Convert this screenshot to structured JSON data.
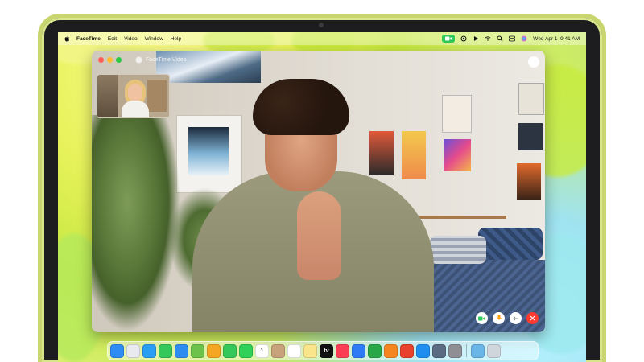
{
  "menubar": {
    "app_name": "FaceTime",
    "items": [
      "Edit",
      "Video",
      "Window",
      "Help"
    ],
    "date_time": "Wed Apr 1  9:41 AM"
  },
  "window": {
    "title": "FaceTime Video",
    "traffic_colors": [
      "#ff5f57",
      "#febc2e",
      "#28c840"
    ]
  },
  "call_controls": [
    {
      "name": "video",
      "color": "#34c759"
    },
    {
      "name": "mic",
      "color": "#ff9f0a"
    },
    {
      "name": "effects",
      "color": "#8e8e93"
    },
    {
      "name": "end-call",
      "color": "#ff3b30"
    }
  ],
  "dock": {
    "apps": [
      {
        "name": "finder",
        "color": "#2f8cf5"
      },
      {
        "name": "launchpad",
        "color": "#e8eaf0"
      },
      {
        "name": "safari",
        "color": "#2a9df4"
      },
      {
        "name": "messages",
        "color": "#34c759"
      },
      {
        "name": "mail",
        "color": "#2d8cf0"
      },
      {
        "name": "maps",
        "color": "#6cc24a"
      },
      {
        "name": "photos",
        "color": "#f5a623"
      },
      {
        "name": "facetime",
        "color": "#34c759"
      },
      {
        "name": "phone",
        "color": "#30d158"
      },
      {
        "name": "calendar",
        "color": "#ffffff",
        "label": "1"
      },
      {
        "name": "contacts",
        "color": "#c8a27a"
      },
      {
        "name": "reminders",
        "color": "#ffffff"
      },
      {
        "name": "notes",
        "color": "#fbe58a"
      },
      {
        "name": "tv",
        "color": "#111111",
        "label": "tv"
      },
      {
        "name": "music",
        "color": "#fa3c55"
      },
      {
        "name": "keynote",
        "color": "#2f7bf5"
      },
      {
        "name": "numbers",
        "color": "#27a745"
      },
      {
        "name": "pages",
        "color": "#f5861f"
      },
      {
        "name": "mirror",
        "color": "#e8412c"
      },
      {
        "name": "app-store",
        "color": "#1f8ef1"
      },
      {
        "name": "iphone-mirroring",
        "color": "#5a6b82"
      },
      {
        "name": "settings",
        "color": "#8e8e93"
      }
    ],
    "trailing": [
      {
        "name": "downloads-folder",
        "color": "#6ab6e8"
      },
      {
        "name": "trash",
        "color": "#cfd6dc"
      }
    ]
  }
}
